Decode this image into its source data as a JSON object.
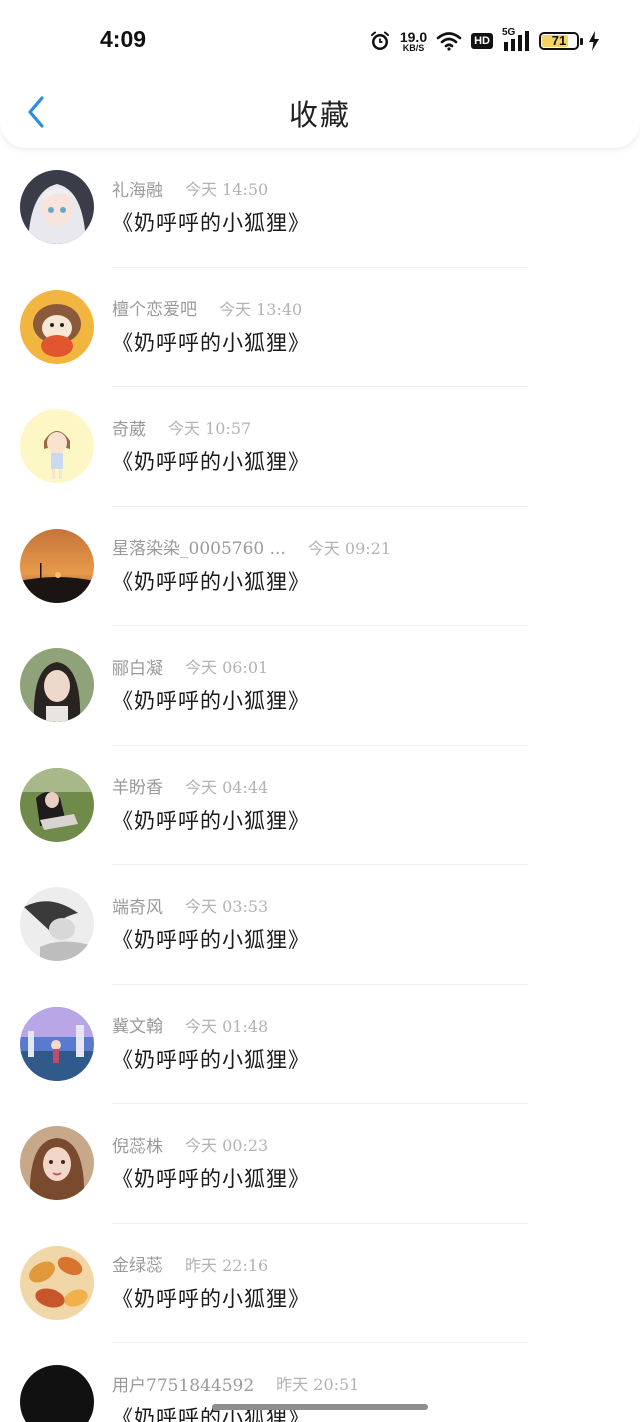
{
  "status_bar": {
    "time": "4:09",
    "net_speed_value": "19.0",
    "net_speed_unit": "KB/S",
    "hd_label": "HD",
    "network_label": "5G",
    "battery_level": "71",
    "battery_fraction": 0.71
  },
  "nav": {
    "back_icon": "chevron-left-icon",
    "title": "收藏"
  },
  "colors": {
    "accent": "#2b8de0",
    "battery_fill": "#f4d35e"
  },
  "favorites": [
    {
      "name": "礼海融",
      "date": "今天 14:50",
      "title": "《奶呼呼的小狐狸》",
      "avatar": "anime-girl-avatar"
    },
    {
      "name": "檀个恋爱吧",
      "date": "今天 13:40",
      "title": "《奶呼呼的小狐狸》",
      "avatar": "hedgehog-avatar"
    },
    {
      "name": "奇葳",
      "date": "今天 10:57",
      "title": "《奶呼呼的小狐狸》",
      "avatar": "cartoon-girl-avatar"
    },
    {
      "name": "星落染染_0005760 ...",
      "date": "今天 09:21",
      "title": "《奶呼呼的小狐狸》",
      "avatar": "sunset-avatar"
    },
    {
      "name": "郦白凝",
      "date": "今天 06:01",
      "title": "《奶呼呼的小狐狸》",
      "avatar": "photo-avatar"
    },
    {
      "name": "羊盼香",
      "date": "今天 04:44",
      "title": "《奶呼呼的小狐狸》",
      "avatar": "grass-photo-avatar"
    },
    {
      "name": "端奇风",
      "date": "今天 03:53",
      "title": "《奶呼呼的小狐狸》",
      "avatar": "bw-photo-avatar"
    },
    {
      "name": "冀文翰",
      "date": "今天 01:48",
      "title": "《奶呼呼的小狐狸》",
      "avatar": "anime-scene-avatar"
    },
    {
      "name": "倪蕊株",
      "date": "今天 00:23",
      "title": "《奶呼呼的小狐狸》",
      "avatar": "portrait-avatar"
    },
    {
      "name": "金绿蕊",
      "date": "昨天 22:16",
      "title": "《奶呼呼的小狐狸》",
      "avatar": "autumn-leaves-avatar"
    },
    {
      "name": "用户7751844592",
      "date": "昨天 20:51",
      "title": "《奶呼呼的小狐狸》",
      "avatar": "default-avatar"
    }
  ]
}
